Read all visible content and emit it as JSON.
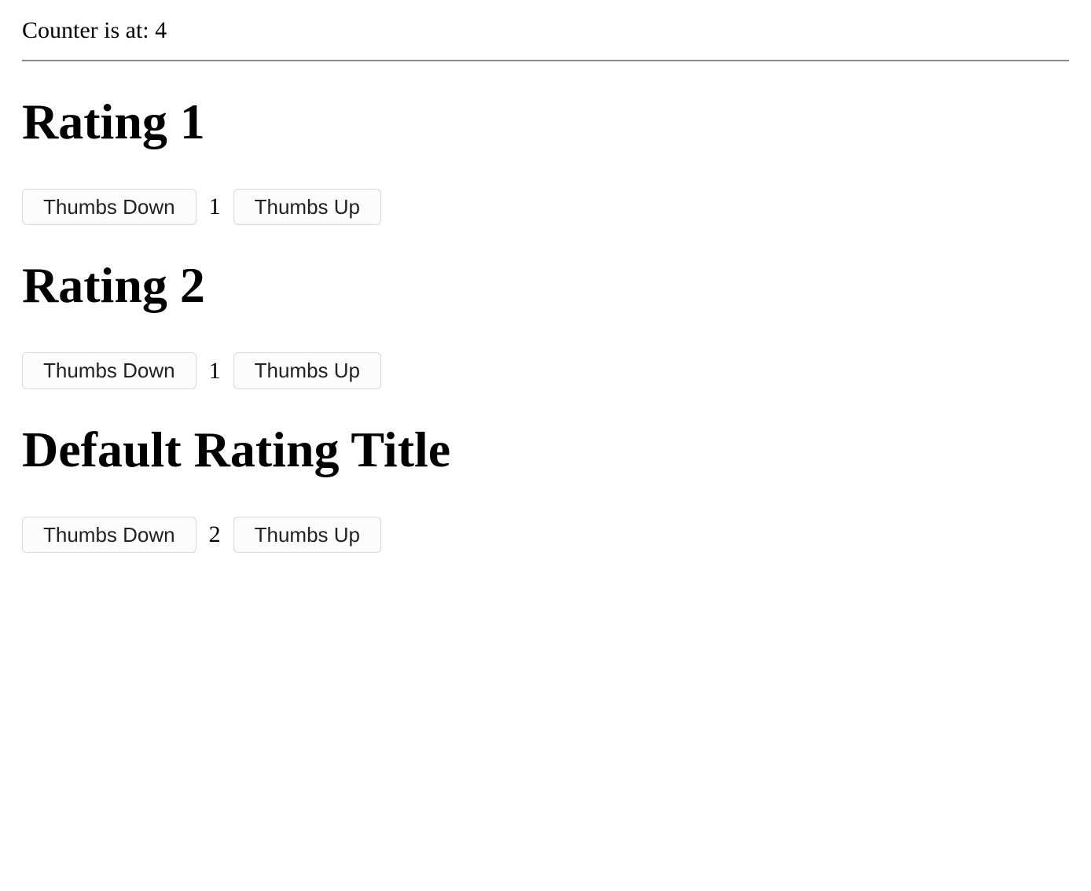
{
  "counter": {
    "label_prefix": "Counter is at: ",
    "value": "4"
  },
  "buttons": {
    "thumbs_down": "Thumbs Down",
    "thumbs_up": "Thumbs Up"
  },
  "ratings": [
    {
      "title": "Rating 1",
      "value": "1"
    },
    {
      "title": "Rating 2",
      "value": "1"
    },
    {
      "title": "Default Rating Title",
      "value": "2"
    }
  ]
}
